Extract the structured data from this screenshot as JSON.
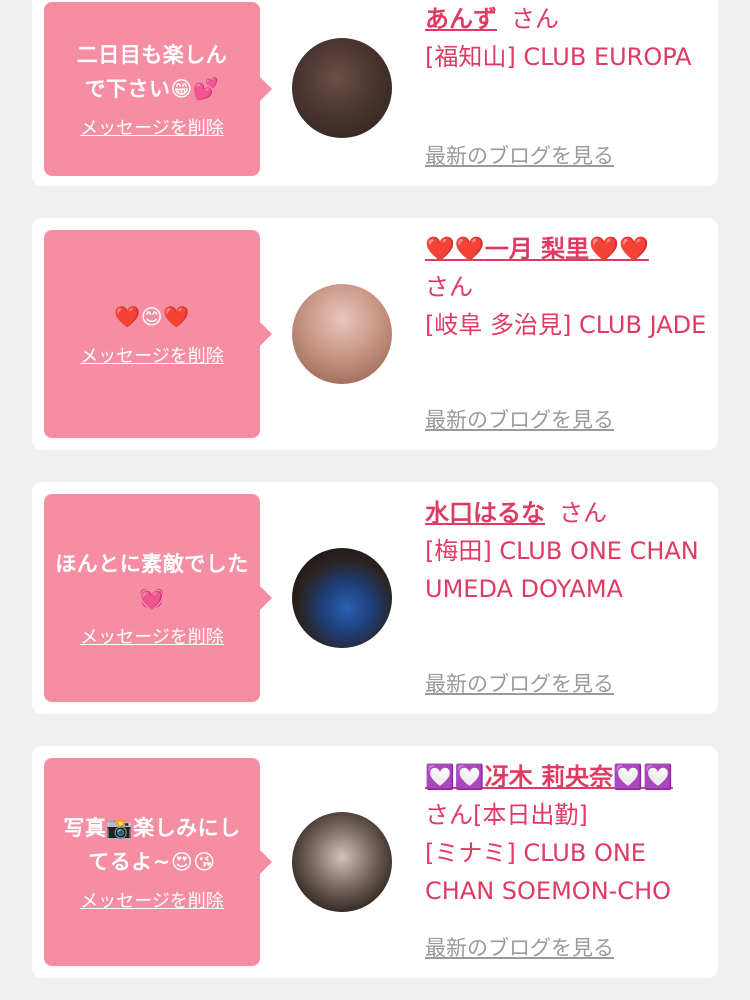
{
  "colors": {
    "accent": "#e03a62",
    "bubble": "#f58ea2",
    "link_gray": "#9a9a9a"
  },
  "cards": [
    {
      "message": "二日目も楽しんで下さい😁💕",
      "delete_label": "メッセージを削除",
      "name": "あんず",
      "honorific": "さん",
      "shop": "[福知山] CLUB EUROPA",
      "blog_link": "最新のブログを見る"
    },
    {
      "message": "❤️😊❤️",
      "delete_label": "メッセージを削除",
      "name_prefix": "❤️❤️",
      "name": "一月 梨里",
      "name_suffix": "❤️❤️",
      "honorific": "さん",
      "shop": "[岐阜 多治見] CLUB JADE",
      "blog_link": "最新のブログを見る"
    },
    {
      "message": "ほんとに素敵でした💓",
      "delete_label": "メッセージを削除",
      "name": "水口はるな",
      "honorific": "さん",
      "shop": "[梅田] CLUB ONE CHAN UMEDA DOYAMA",
      "blog_link": "最新のブログを見る"
    },
    {
      "message": "写真📸楽しみにしてるよ~😍😘",
      "delete_label": "メッセージを削除",
      "name_prefix": "💟💟",
      "name": "冴木 莉央奈",
      "name_suffix": "💟💟",
      "honorific": "さん[本日出勤]",
      "shop": "[ミナミ] CLUB ONE CHAN SOEMON-CHO",
      "blog_link": "最新のブログを見る"
    }
  ]
}
